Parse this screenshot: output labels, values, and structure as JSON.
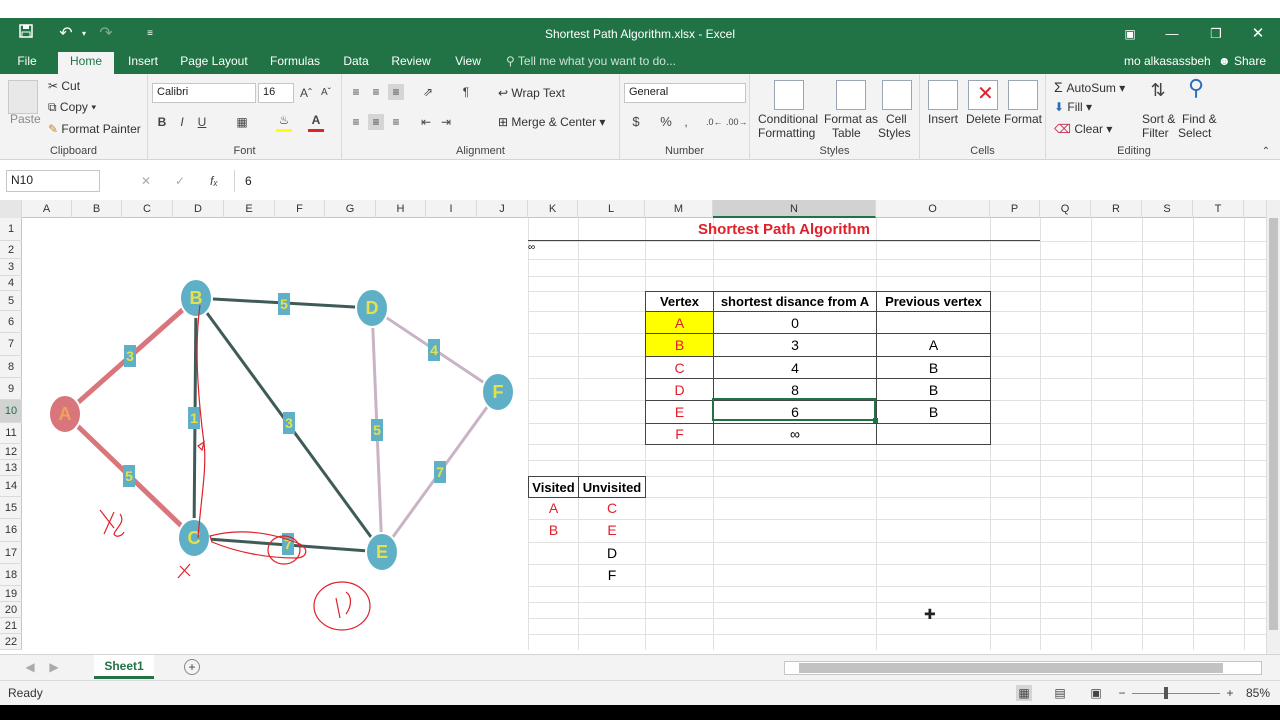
{
  "window": {
    "title": "Shortest Path Algorithm.xlsx - Excel"
  },
  "tabs": [
    "File",
    "Home",
    "Insert",
    "Page Layout",
    "Formulas",
    "Data",
    "Review",
    "View"
  ],
  "tell_me": "Tell me what you want to do...",
  "user": "mo alkasassbeh",
  "share": "Share",
  "clipboard": {
    "paste": "Paste",
    "cut": "Cut",
    "copy": "Copy",
    "format_painter": "Format Painter",
    "label": "Clipboard"
  },
  "font": {
    "name": "Calibri",
    "size": "16",
    "bold": "B",
    "italic": "I",
    "underline": "U",
    "label": "Font"
  },
  "alignment": {
    "wrap": "Wrap Text",
    "merge": "Merge & Center",
    "label": "Alignment"
  },
  "number": {
    "format": "General",
    "label": "Number"
  },
  "styles": {
    "conditional": "Conditional",
    "conditional2": "Formatting",
    "format_as": "Format as",
    "format_as2": "Table",
    "cell": "Cell",
    "cell2": "Styles",
    "label": "Styles"
  },
  "cells": {
    "insert": "Insert",
    "delete": "Delete",
    "format": "Format",
    "label": "Cells"
  },
  "editing": {
    "autosum": "AutoSum",
    "fill": "Fill",
    "clear": "Clear",
    "sort": "Sort &",
    "sort2": "Filter",
    "find": "Find &",
    "find2": "Select",
    "label": "Editing"
  },
  "formula_bar": {
    "name_box": "N10",
    "value": "6"
  },
  "columns": [
    "A",
    "B",
    "C",
    "D",
    "E",
    "F",
    "G",
    "H",
    "I",
    "J",
    "K",
    "L",
    "M",
    "N",
    "O",
    "P",
    "Q",
    "R",
    "S",
    "T"
  ],
  "rows": [
    "1",
    "2",
    "3",
    "4",
    "5",
    "6",
    "7",
    "8",
    "9",
    "10",
    "11",
    "12",
    "13",
    "14",
    "15",
    "16",
    "17",
    "18",
    "19",
    "20",
    "21",
    "22"
  ],
  "sheet": {
    "title": "Shortest Path Algorithm",
    "k2": "∞",
    "headers": [
      "Vertex",
      "shortest disance from A",
      "Previous vertex"
    ],
    "table": [
      {
        "vertex": "A",
        "dist": "0",
        "prev": ""
      },
      {
        "vertex": "B",
        "dist": "3",
        "prev": "A"
      },
      {
        "vertex": "C",
        "dist": "4",
        "prev": "B"
      },
      {
        "vertex": "D",
        "dist": "8",
        "prev": "B"
      },
      {
        "vertex": "E",
        "dist": "6",
        "prev": "B"
      },
      {
        "vertex": "F",
        "dist": "∞",
        "prev": ""
      }
    ],
    "visited_header": "Visited",
    "unvisited_header": "Unvisited",
    "visited": [
      "A",
      "B"
    ],
    "unvisited": [
      "C",
      "E",
      "D",
      "F"
    ]
  },
  "graph": {
    "nodes": [
      "A",
      "B",
      "C",
      "D",
      "E",
      "F"
    ],
    "edge_weights": {
      "AB": "3",
      "AC": "5",
      "BD": "5",
      "BC": "1",
      "BE": "3",
      "DE": "5",
      "DF": "4",
      "FE": "7",
      "CE": "7"
    },
    "node_color": "#5fb0c6",
    "node_a_color": "#d9767b",
    "node_text_color": "#e6e04a"
  },
  "sheet_tab": "Sheet1",
  "status": {
    "ready": "Ready",
    "zoom": "85%"
  },
  "colors": {
    "accent": "#217346",
    "red": "#e0202a",
    "highlight": "#ffff00"
  }
}
